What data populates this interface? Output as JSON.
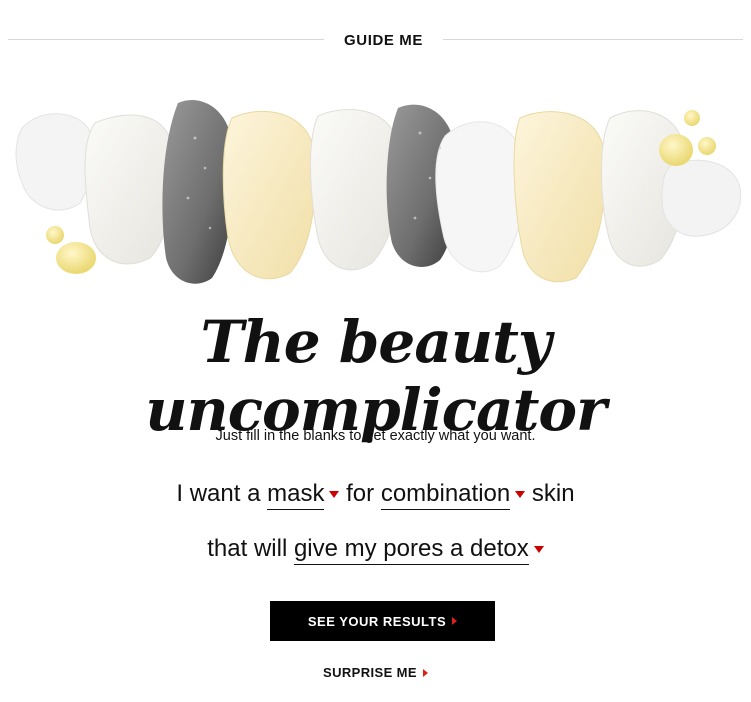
{
  "header": {
    "title": "GUIDE ME"
  },
  "hero": {
    "image_label": "product swatches"
  },
  "headline": "The beauty uncomplicator",
  "subtitle": "Just fill in the blanks to get exactly what you want.",
  "sentence": {
    "prefix": "I want a",
    "product": "mask",
    "middle": "for",
    "skin_type": "combination",
    "suffix": "skin",
    "line2_prefix": "that will",
    "concern": "give my pores a detox"
  },
  "cta": {
    "label": "SEE YOUR RESULTS"
  },
  "surprise": {
    "label": "SURPRISE ME"
  },
  "colors": {
    "accent": "#cc0000",
    "button_bg": "#000000",
    "text": "#111111"
  }
}
